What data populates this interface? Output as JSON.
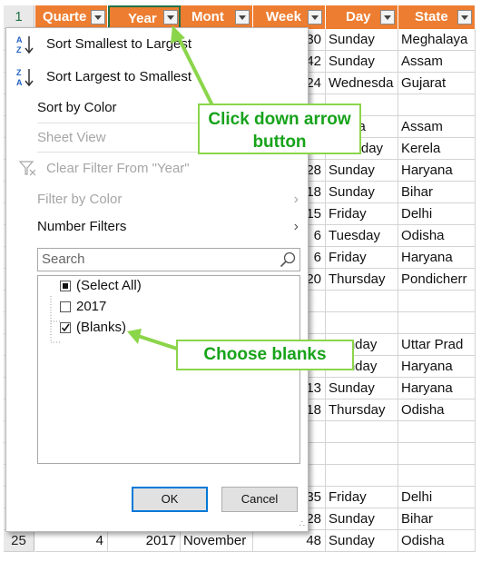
{
  "header": {
    "row_number": "1",
    "columns": [
      {
        "label": "Quarte"
      },
      {
        "label": "Year"
      },
      {
        "label": "Mont"
      },
      {
        "label": "Week"
      },
      {
        "label": "Day"
      },
      {
        "label": "State"
      }
    ]
  },
  "visible_rows": [
    {
      "week": "30",
      "day": "Sunday",
      "state": "Meghalaya"
    },
    {
      "week": "42",
      "day": "Sunday",
      "state": "Assam"
    },
    {
      "week": "24",
      "day": "Wednesda",
      "state": "Gujarat"
    },
    {
      "week": "",
      "day": "",
      "state": ""
    },
    {
      "week": "",
      "day": "nesda",
      "state": "Assam"
    },
    {
      "week": "28",
      "day": "Saturday",
      "state": "Kerela"
    },
    {
      "week": "28",
      "day": "Sunday",
      "state": "Haryana"
    },
    {
      "week": "18",
      "day": "Sunday",
      "state": "Bihar"
    },
    {
      "week": "15",
      "day": "Friday",
      "state": "Delhi"
    },
    {
      "week": "6",
      "day": "Tuesday",
      "state": "Odisha"
    },
    {
      "week": "6",
      "day": "Friday",
      "state": "Haryana"
    },
    {
      "week": "20",
      "day": "Thursday",
      "state": "Pondicherr"
    },
    {
      "week": "",
      "day": "",
      "state": ""
    },
    {
      "week": "",
      "day": "",
      "state": ""
    },
    {
      "week": "",
      "day": "Monday",
      "state": "Uttar Prad"
    },
    {
      "week": "15",
      "day": "Monday",
      "state": "Haryana"
    },
    {
      "week": "13",
      "day": "Sunday",
      "state": "Haryana"
    },
    {
      "week": "18",
      "day": "Thursday",
      "state": "Odisha"
    },
    {
      "week": "",
      "day": "",
      "state": ""
    },
    {
      "week": "",
      "day": "",
      "state": ""
    },
    {
      "week": "",
      "day": "",
      "state": ""
    },
    {
      "week": "35",
      "day": "Friday",
      "state": "Delhi"
    },
    {
      "week": "28",
      "day": "Sunday",
      "state": "Bihar"
    }
  ],
  "last_row": {
    "row_number": "25",
    "quarter": "4",
    "year": "2017",
    "month": "November",
    "week": "48",
    "day": "Sunday",
    "state": "Odisha"
  },
  "filter_menu": {
    "sort_asc": "Sort Smallest to Largest",
    "sort_desc": "Sort Largest to Smallest",
    "sort_by_color": "Sort by Color",
    "sheet_view": "Sheet View",
    "clear_filter": "Clear Filter From \"Year\"",
    "filter_by_color": "Filter by Color",
    "number_filters": "Number Filters",
    "search_placeholder": "Search",
    "items": [
      {
        "label": "(Select All)",
        "state": "partial"
      },
      {
        "label": "2017",
        "state": "unchecked"
      },
      {
        "label": "(Blanks)",
        "state": "checked"
      }
    ],
    "ok_label": "OK",
    "cancel_label": "Cancel"
  },
  "callouts": {
    "top": "Click down arrow button",
    "bottom": "Choose blanks"
  },
  "colors": {
    "header": "#ed7d31",
    "callout_text": "#17a31a",
    "callout_border": "#8bd54a"
  }
}
